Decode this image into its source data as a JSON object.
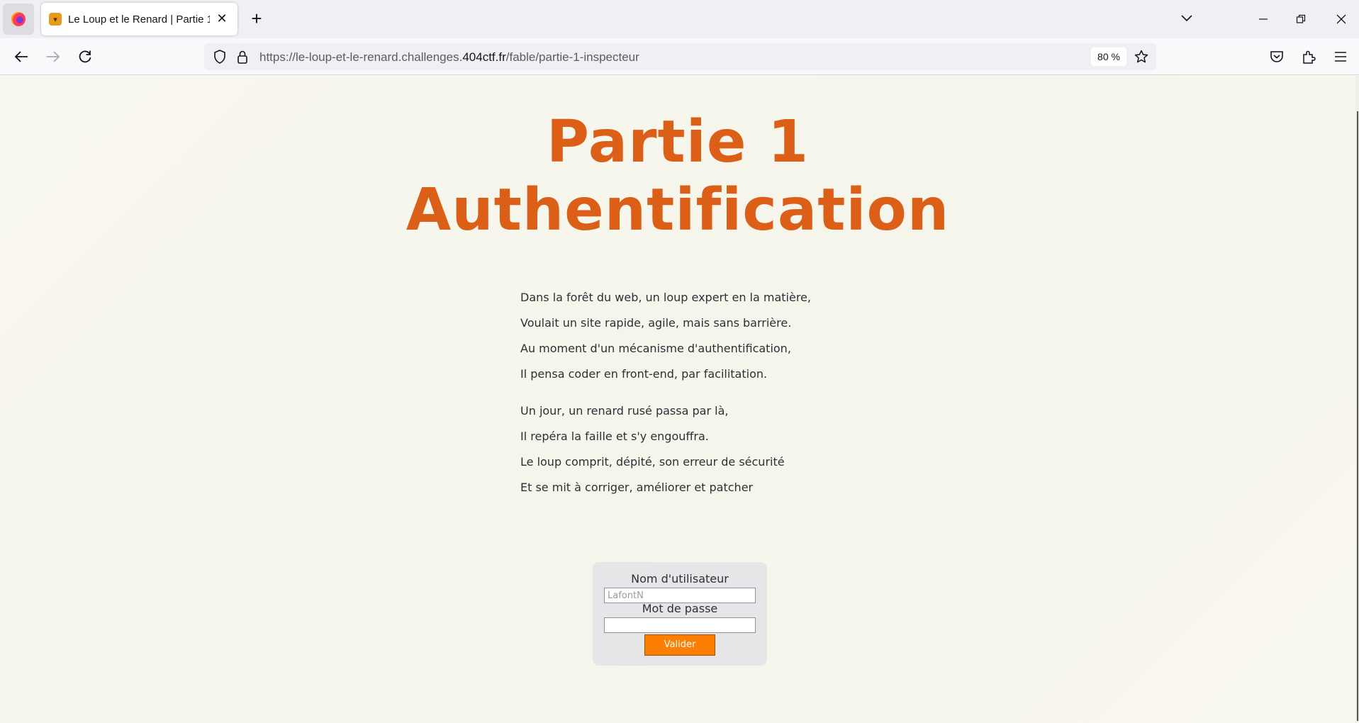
{
  "browser": {
    "tab": {
      "title": "Le Loup et le Renard | Partie 1"
    },
    "url": {
      "prefix": "https://le-loup-et-le-renard.challenges.",
      "domain": "404ctf.fr",
      "path": "/fable/partie-1-inspecteur"
    },
    "zoom": "80 %"
  },
  "page": {
    "title_line1": "Partie 1",
    "title_line2": "Authentification",
    "stanza1": [
      "Dans la forêt du web, un loup expert en la matière,",
      "Voulait un site rapide, agile, mais sans barrière.",
      "Au moment d'un mécanisme d'authentification,",
      "Il pensa coder en front-end, par facilitation."
    ],
    "stanza2": [
      "Un jour, un renard rusé passa par là,",
      "Il repéra la faille et s'y engouffra.",
      "Le loup comprit, dépité, son erreur de sécurité",
      "Et se mit à corriger, améliorer et patcher"
    ],
    "login": {
      "username_label": "Nom d'utilisateur",
      "username_placeholder": "LafontN",
      "password_label": "Mot de passe",
      "submit_label": "Valider"
    }
  },
  "colors": {
    "heading": "#dc5f17",
    "button": "#fc7f03"
  }
}
